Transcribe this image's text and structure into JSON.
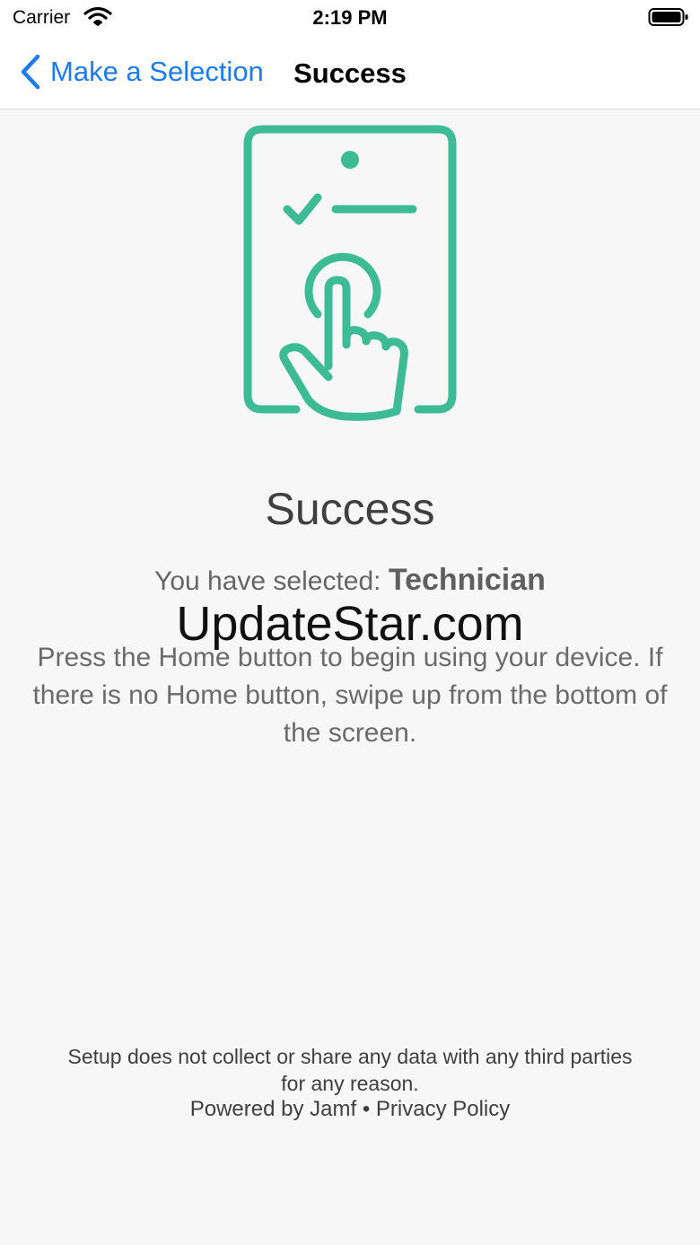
{
  "status_bar": {
    "carrier": "Carrier",
    "time": "2:19 PM"
  },
  "nav": {
    "back_label": "Make a Selection",
    "title": "Success"
  },
  "content": {
    "heading": "Success",
    "selected_prefix": "You have selected: ",
    "selected_value": "Technician",
    "instructions": "Press the Home button to begin using your device. If there is no Home button, swipe up from the bottom of the screen."
  },
  "watermark": "UpdateStar.com",
  "footer": {
    "privacy_note": "Setup does not collect or share any data with any third parties for any reason.",
    "powered_by": "Powered by Jamf",
    "separator": "•",
    "privacy_policy": "Privacy Policy"
  },
  "colors": {
    "accent": "#1a7cf0",
    "illustration": "#3dbb94",
    "background": "#f7f7f7"
  },
  "icons": {
    "wifi": "wifi-icon",
    "battery": "battery-icon",
    "back": "chevron-left-icon",
    "hero": "tablet-tap-icon"
  }
}
